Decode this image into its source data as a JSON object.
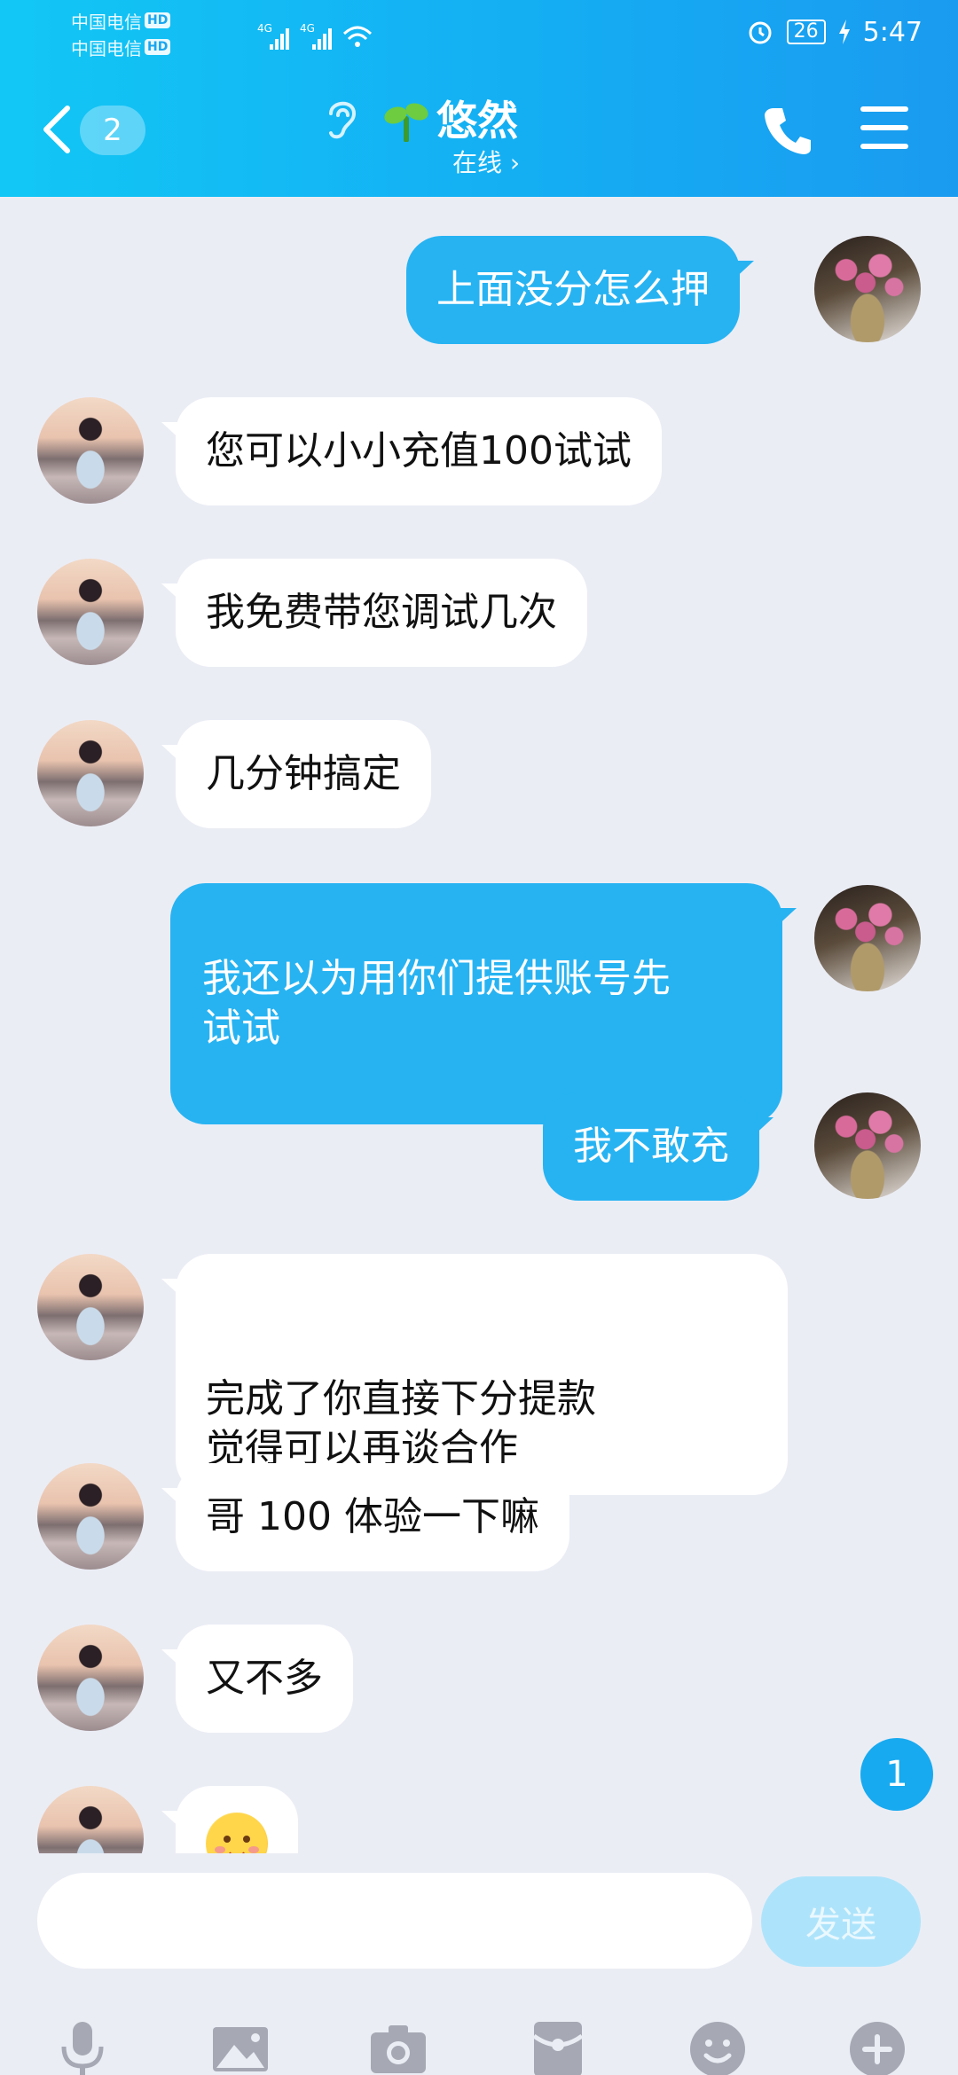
{
  "status_bar": {
    "carrier1": "中国电信",
    "carrier2": "中国电信",
    "hd": "HD",
    "net_label": "4G",
    "battery": "26",
    "time": "5:47"
  },
  "header": {
    "unread_count": "2",
    "contact_name": "悠然",
    "contact_status": "在线 ›"
  },
  "messages": [
    {
      "side": "out",
      "text": "上面没分怎么押"
    },
    {
      "side": "in",
      "text": "您可以小小充值100试试"
    },
    {
      "side": "in",
      "text": "我免费带您调试几次"
    },
    {
      "side": "in",
      "text": "几分钟搞定"
    },
    {
      "side": "out",
      "text": "我还以为用你们提供账号先\n试试"
    },
    {
      "side": "out",
      "text": "我不敢充"
    },
    {
      "side": "in",
      "text": "完成了你直接下分提款\n觉得可以再谈合作"
    },
    {
      "side": "in",
      "text": "哥 100 体验一下嘛"
    },
    {
      "side": "in",
      "text": "又不多"
    },
    {
      "side": "in",
      "emoji": "smiling-face-emoji"
    }
  ],
  "new_message_badge": "1",
  "input": {
    "placeholder": "",
    "send_label": "发送"
  },
  "toolbar": [
    "mic-icon",
    "image-icon",
    "camera-icon",
    "red-packet-icon",
    "emoji-icon",
    "plus-icon"
  ],
  "colors": {
    "header_gradient_start": "#12c7f5",
    "header_gradient_end": "#1a9bf0",
    "outgoing_bubble": "#27b3f2",
    "incoming_bubble": "#ffffff",
    "chat_background": "#ebedf5",
    "send_button": "#aee4fb"
  }
}
